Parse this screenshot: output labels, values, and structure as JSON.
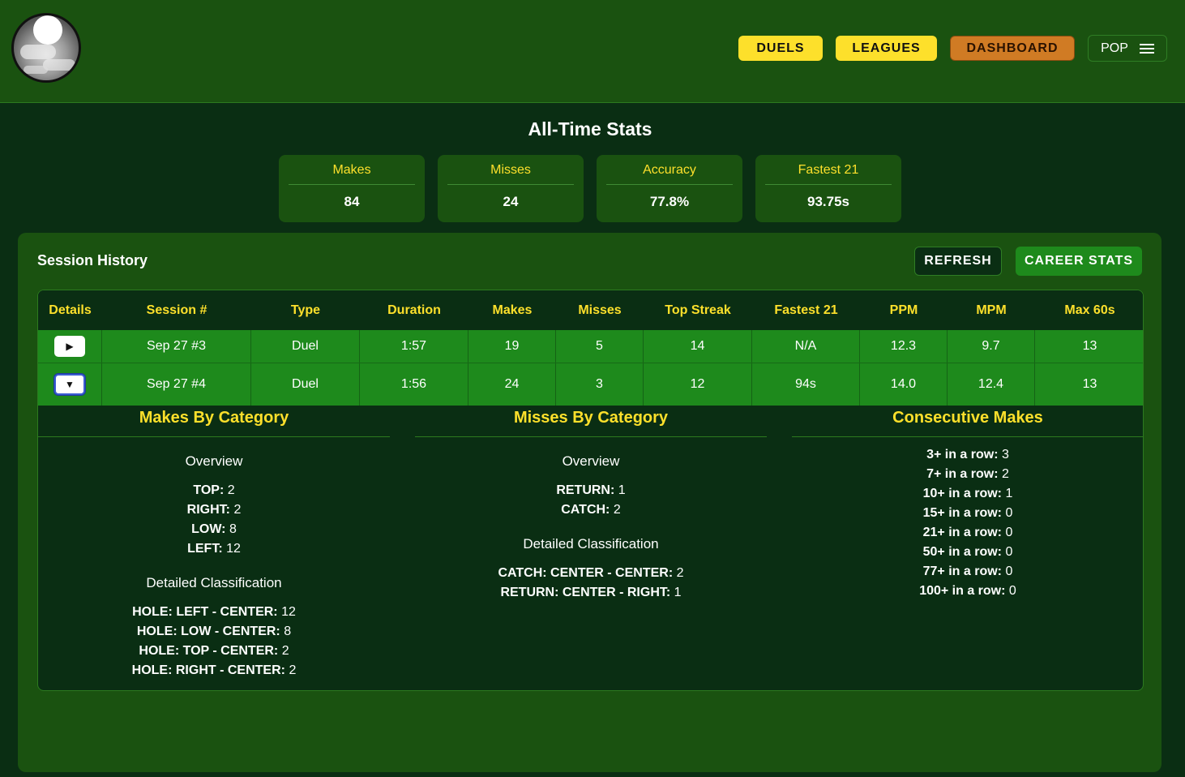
{
  "nav": {
    "duels": "DUELS",
    "leagues": "LEAGUES",
    "dashboard": "DASHBOARD",
    "pop": "POP"
  },
  "stats": {
    "title": "All-Time Stats",
    "cards": [
      {
        "label": "Makes",
        "value": "84"
      },
      {
        "label": "Misses",
        "value": "24"
      },
      {
        "label": "Accuracy",
        "value": "77.8%"
      },
      {
        "label": "Fastest 21",
        "value": "93.75s"
      }
    ]
  },
  "history": {
    "title": "Session History",
    "refresh": "REFRESH",
    "career": "CAREER STATS",
    "columns": [
      "Details",
      "Session #",
      "Type",
      "Duration",
      "Makes",
      "Misses",
      "Top Streak",
      "Fastest 21",
      "PPM",
      "MPM",
      "Max 60s"
    ],
    "rows": [
      {
        "toggle": "▶",
        "session": "Sep 27 #3",
        "type": "Duel",
        "duration": "1:57",
        "makes": "19",
        "misses": "5",
        "streak": "14",
        "fastest": "N/A",
        "ppm": "12.3",
        "mpm": "9.7",
        "max60": "13"
      },
      {
        "toggle": "▼",
        "session": "Sep 27 #4",
        "type": "Duel",
        "duration": "1:56",
        "makes": "24",
        "misses": "3",
        "streak": "12",
        "fastest": "94s",
        "ppm": "14.0",
        "mpm": "12.4",
        "max60": "13"
      }
    ]
  },
  "details": {
    "makes": {
      "title": "Makes By Category",
      "overview": "Overview",
      "overview_items": [
        {
          "k": "TOP:",
          "v": "2"
        },
        {
          "k": "RIGHT:",
          "v": "2"
        },
        {
          "k": "LOW:",
          "v": "8"
        },
        {
          "k": "LEFT:",
          "v": "12"
        }
      ],
      "detailed": "Detailed Classification",
      "detailed_items": [
        {
          "k": "HOLE: LEFT - CENTER:",
          "v": "12"
        },
        {
          "k": "HOLE: LOW - CENTER:",
          "v": "8"
        },
        {
          "k": "HOLE: TOP - CENTER:",
          "v": "2"
        },
        {
          "k": "HOLE: RIGHT - CENTER:",
          "v": "2"
        }
      ]
    },
    "misses": {
      "title": "Misses By Category",
      "overview": "Overview",
      "overview_items": [
        {
          "k": "RETURN:",
          "v": "1"
        },
        {
          "k": "CATCH:",
          "v": "2"
        }
      ],
      "detailed": "Detailed Classification",
      "detailed_items": [
        {
          "k": "CATCH: CENTER - CENTER:",
          "v": "2"
        },
        {
          "k": "RETURN: CENTER - RIGHT:",
          "v": "1"
        }
      ]
    },
    "consecutive": {
      "title": "Consecutive Makes",
      "items": [
        {
          "k": "3+ in a row:",
          "v": "3"
        },
        {
          "k": "7+ in a row:",
          "v": "2"
        },
        {
          "k": "10+ in a row:",
          "v": "1"
        },
        {
          "k": "15+ in a row:",
          "v": "0"
        },
        {
          "k": "21+ in a row:",
          "v": "0"
        },
        {
          "k": "50+ in a row:",
          "v": "0"
        },
        {
          "k": "77+ in a row:",
          "v": "0"
        },
        {
          "k": "100+ in a row:",
          "v": "0"
        }
      ]
    }
  }
}
